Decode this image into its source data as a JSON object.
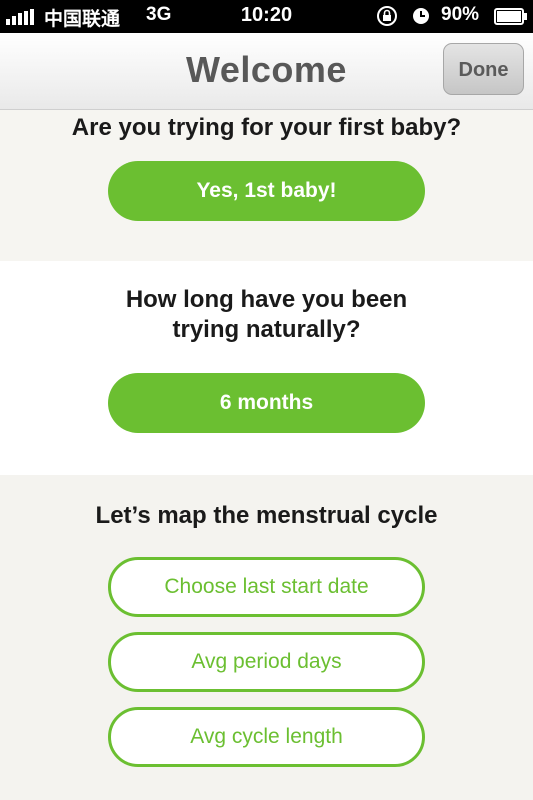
{
  "status_bar": {
    "carrier": "中国联通",
    "network": "3G",
    "time": "10:20",
    "battery": "90%"
  },
  "nav": {
    "title": "Welcome",
    "done_label": "Done"
  },
  "sections": {
    "first_baby": {
      "question": "Are you trying for your first baby?",
      "answer": "Yes, 1st baby!"
    },
    "trying": {
      "question_line1": "How long have you been",
      "question_line2": "trying naturally?",
      "answer": "6 months"
    },
    "cycle": {
      "heading": "Let’s map the menstrual cycle",
      "start_date_label": "Choose last start date",
      "period_days_label": "Avg period days",
      "cycle_length_label": "Avg cycle length"
    }
  },
  "colors": {
    "accent_green": "#6bbf31",
    "status_bar_bg": "#000000"
  }
}
